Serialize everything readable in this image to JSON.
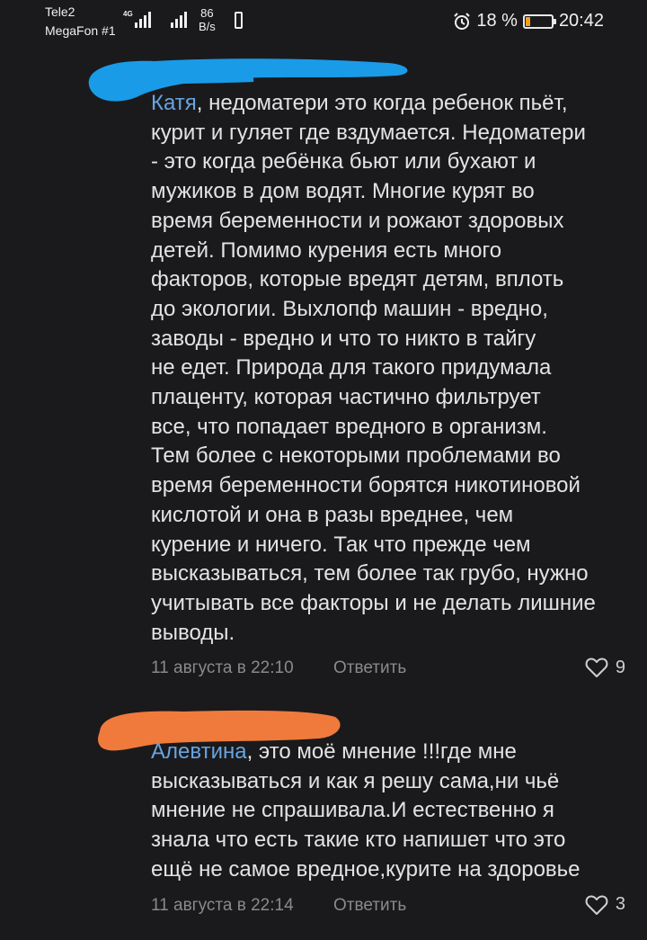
{
  "status_bar": {
    "carrier1": "Tele2",
    "carrier2": "MegaFon #1",
    "network": "4G",
    "speed_value": "86",
    "speed_unit": "B/s",
    "battery": "18 %",
    "battery_level": 0.18,
    "time": "20:42"
  },
  "comments": [
    {
      "author": "Катя",
      "text": ", недоматери это когда ребенок пьёт,\nкурит и гуляет где вздумается. Недоматери\n- это когда ребёнка бьют или бухают и\nмужиков в дом водят. Многие курят во\nвремя беременности и рожают здоровых\nдетей. Помимо курения есть много\nфакторов, которые вредят детям, вплоть\nдо экологии. Выхлопф машин - вредно,\nзаводы - вредно и что то никто в тайгу\nне едет. Природа для такого придумала\nплаценту, которая частично фильтрует\nвсе, что попадает вредного в организм.\nТем более с некоторыми проблемами во\nвремя беременности борятся никотиновой\nкислотой и она в разы вреднее, чем\nкурение и ничего. Так что прежде чем\nвысказываться, тем более так грубо, нужно\nучитывать все факторы и не делать лишние\nвыводы.",
      "date": "11 августа в 22:10",
      "reply": "Ответить",
      "likes": "9"
    },
    {
      "author": "Алевтина",
      "text": ", это моё мнение !!!где мне\nвысказываться и как я решу сама,ни чьё\nмнение не спрашивала.И естественно я\nзнала что есть такие кто напишет что это\nещё не самое вредное,курите на здоровье",
      "date": "11 августа в 22:14",
      "reply": "Ответить",
      "likes": "3"
    }
  ],
  "colors": {
    "background": "#1a1a1c",
    "author_link": "#69a4e0",
    "blur_blue": "#1a9be8",
    "blur_orange": "#f07a3c",
    "battery_fill": "#f0a21b"
  },
  "icons": {
    "alarm": "alarm-clock-icon",
    "like": "heart-outline-icon",
    "signal": "signal-bars-icon",
    "battery": "battery-icon"
  }
}
